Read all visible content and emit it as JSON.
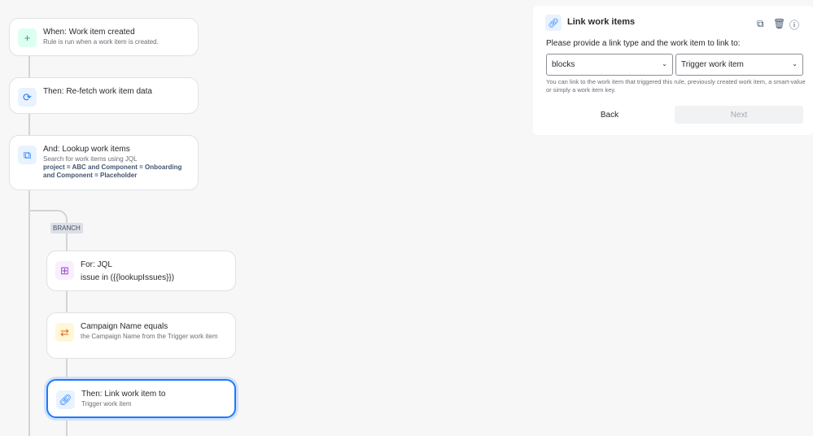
{
  "flow": [
    {
      "title": "When: Work item created",
      "sub": "Rule is run when a work item is created.",
      "icon": "plus-icon"
    },
    {
      "title": "Then: Re-fetch work item data",
      "icon": "refresh-icon"
    },
    {
      "title": "And: Lookup work items",
      "sub": "Search for work items using JQL",
      "bold": "project = ABC and Component = Onboarding and Component = Placeholder",
      "icon": "lookup-icon"
    }
  ],
  "branch_label": "BRANCH",
  "branch": [
    {
      "title": "For: JQL",
      "sub": "issue in ({{lookupIssues}})",
      "icon": "branch-icon"
    },
    {
      "title": "Campaign Name equals",
      "sub": "the Campaign Name from the Trigger work item",
      "icon": "swap-icon"
    },
    {
      "title": "Then: Link work item to",
      "sub": "Trigger work item",
      "icon": "link-icon"
    }
  ],
  "panel": {
    "title": "Link work items",
    "prompt": "Please provide a link type and the work item to link to:",
    "link_type": "blocks",
    "target": "Trigger work item",
    "help": "You can link to the work item that triggered this rule, previously created work item, a smart-value or simply a work item key.",
    "back": "Back",
    "next": "Next"
  }
}
